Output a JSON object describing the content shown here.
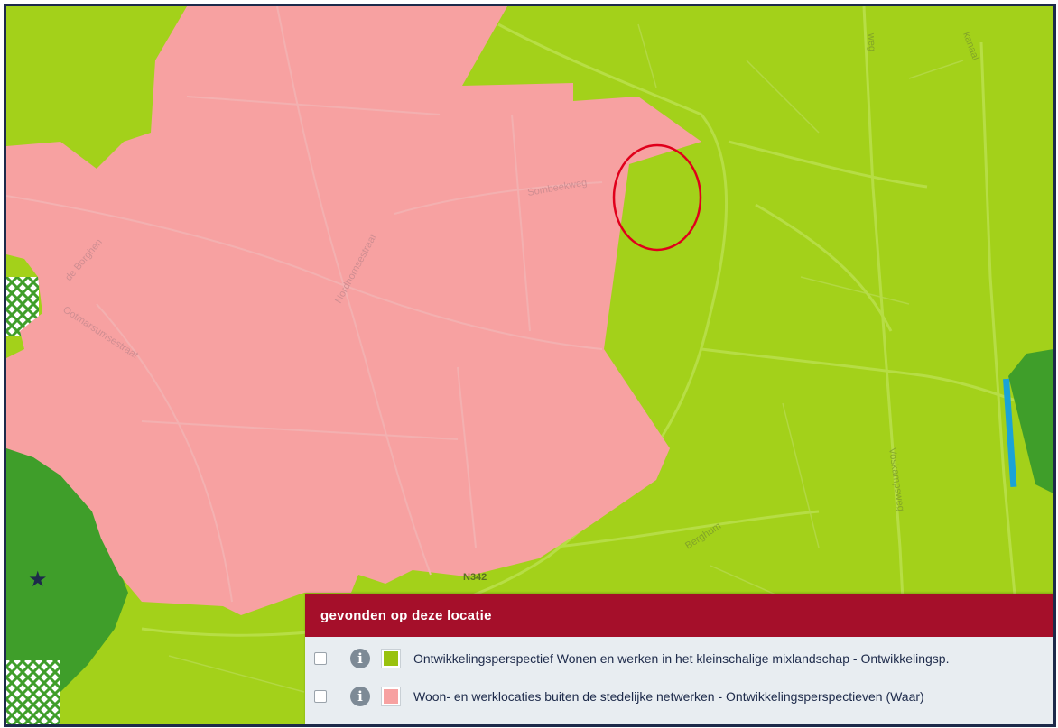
{
  "map": {
    "street_labels": {
      "sombeekweg": "Sombeekweg",
      "de_borghen": "de Borghen",
      "nordhornsestraat": "Nordhornsestraat",
      "ootmarsumsestraat": "Ootmarsumsestraat",
      "berghum": "Berghum",
      "voskampsweg": "Voskampsweg",
      "weg_north": "weg",
      "kanaal": "kanaal"
    },
    "road_label": "N342",
    "colors": {
      "mixlandschap": "#a3d11a",
      "woon_werk": "#f7a1a1",
      "forest": "#3f9e2a",
      "water": "#1aa3d6",
      "marker": "#c8102e"
    }
  },
  "panel": {
    "header": "gevonden op deze locatie",
    "items": [
      {
        "label": "Ontwikkelingsperspectief Wonen en werken in het kleinschalige mixlandschap - Ontwikkelingsp.",
        "color": "#99c20e"
      },
      {
        "label": "Woon- en werklocaties buiten de stedelijke netwerken - Ontwikkelingsperspectieven (Waar)",
        "color": "#f7a1a1"
      }
    ]
  }
}
